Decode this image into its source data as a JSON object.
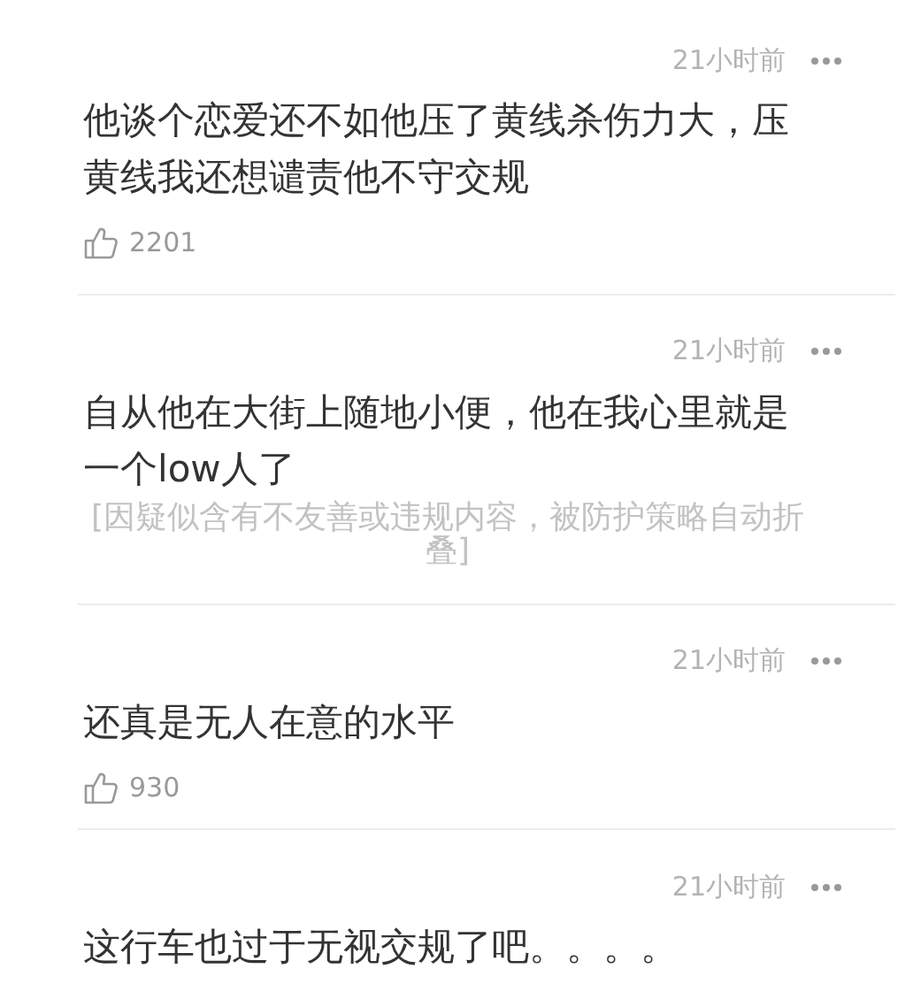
{
  "comments": [
    {
      "time": "21小时前",
      "text": "他谈个恋爱还不如他压了黄线杀伤力大，压黄线我还想谴责他不守交规",
      "likes": "2201"
    },
    {
      "time": "21小时前",
      "text": "自从他在大街上随地小便，他在我心里就是一个low人了",
      "notice": "[因疑似含有不友善或违规内容，被防护策略自动折叠]"
    },
    {
      "time": "21小时前",
      "text": "还真是无人在意的水平",
      "likes": "930"
    },
    {
      "time": "21小时前",
      "text": "这行车也过于无视交规了吧。。。。"
    }
  ]
}
